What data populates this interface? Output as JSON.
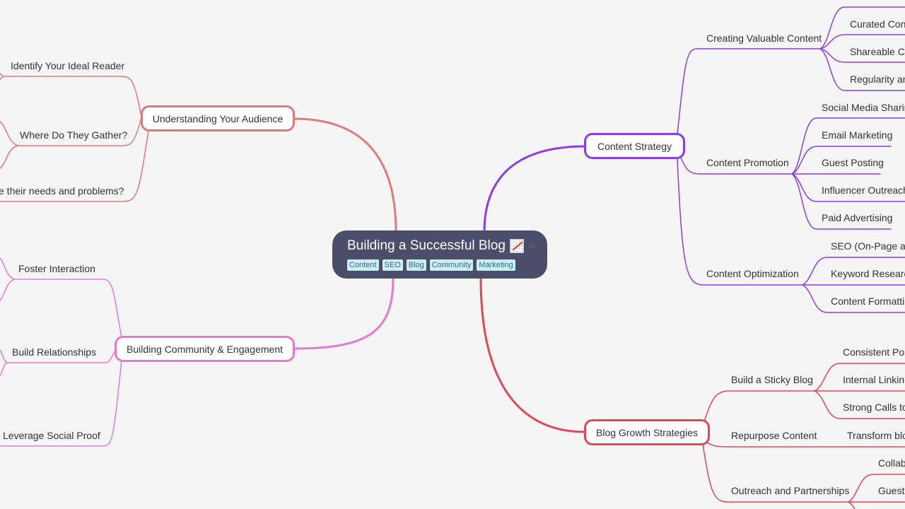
{
  "root": {
    "title": "Building a Successful Blog",
    "icons": [
      "chart-increasing-icon",
      "edit-icon"
    ],
    "tags": [
      "Content",
      "SEO",
      "Blog",
      "Community",
      "Marketing"
    ],
    "background": "#4b4e6a"
  },
  "branches": {
    "audience": {
      "label": "Understanding Your Audience",
      "color": "#e07a7a",
      "children": [
        "Identify Your Ideal Reader",
        "Where Do They Gather?",
        "What are their needs and problems?"
      ],
      "visible_children": [
        "Identify Your Ideal Reader",
        "Where Do They Gather?",
        "e their needs and problems?"
      ]
    },
    "community": {
      "label": "Building Community & Engagement",
      "color": "#e57ad1",
      "children": [
        "Foster Interaction",
        "Build Relationships",
        "Leverage Social Proof"
      ]
    },
    "content": {
      "label": "Content Strategy",
      "color": "#8a3ee8",
      "children": [
        {
          "label": "Creating Valuable Content",
          "children": [
            "Curated Cont",
            "Shareable Co",
            "Regularity an"
          ]
        },
        {
          "label": "Content Promotion",
          "children": [
            "Social Media Sharin",
            "Email Marketing",
            "Guest Posting",
            "Influencer Outreach",
            "Paid Advertising"
          ]
        },
        {
          "label": "Content Optimization",
          "children": [
            "SEO (On-Page and",
            "Keyword Researc",
            "Content Formattin"
          ]
        }
      ]
    },
    "growth": {
      "label": "Blog Growth Strategies",
      "color": "#e0485a",
      "children": [
        {
          "label": "Build a Sticky Blog",
          "children": [
            "Consistent Pos",
            "Internal Linkin",
            "Strong Calls to"
          ]
        },
        {
          "label": "Repurpose Content",
          "children": [
            "Transform blo"
          ]
        },
        {
          "label": "Outreach and Partnerships",
          "children": [
            "Collab",
            "Guest"
          ]
        }
      ]
    }
  }
}
